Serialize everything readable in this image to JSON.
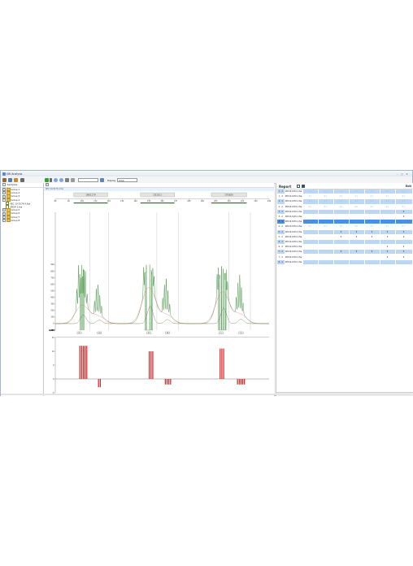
{
  "window": {
    "title": "SW Analysis",
    "buttons": {
      "minimize": "–",
      "maximize": "□",
      "close": "✕"
    }
  },
  "toolbar": {
    "zoom_value": "",
    "display_label": "Display",
    "display_value": "Area"
  },
  "navigator": {
    "header": "Samples",
    "items": [
      {
        "label": "Group 1",
        "type": "folder",
        "level": 0
      },
      {
        "label": "Group 2",
        "type": "folder",
        "level": 0
      },
      {
        "label": "Group 3",
        "type": "folder",
        "level": 0
      },
      {
        "label": "Group 4",
        "type": "folder",
        "level": 0,
        "expanded": true
      },
      {
        "label": "SEC 10-0176 A.fsa",
        "type": "file",
        "level": 1
      },
      {
        "label": "SRCM 1.fsa",
        "type": "file",
        "level": 1
      },
      {
        "label": "Group 5",
        "type": "folder",
        "level": 0
      },
      {
        "label": "Group 6",
        "type": "folder",
        "level": 0
      },
      {
        "label": "Group 7",
        "type": "folder",
        "level": 0
      },
      {
        "label": "Group 8",
        "type": "folder",
        "level": 0
      }
    ]
  },
  "center": {
    "path_text": "",
    "sample_tab": "SEC 10-0176 A.fsa"
  },
  "markers": [
    {
      "name": "D8S1179"
    },
    {
      "name": "D21S11"
    },
    {
      "name": "D7S820"
    }
  ],
  "chart_data": {
    "type": "line",
    "title": "",
    "xlabel": "",
    "ylabel": "",
    "ylim": [
      -200,
      2400
    ],
    "y_ticks": [
      "2,400",
      "2,200",
      "2,000",
      "1,800",
      "1,600",
      "1,400",
      "1,200",
      "1,000",
      "900",
      "800",
      "700",
      "600",
      "500",
      "400",
      "300",
      "200",
      "100",
      "0",
      "-100"
    ],
    "x_ticks": [
      "80",
      "90",
      "100",
      "110",
      "120",
      "130",
      "140",
      "150",
      "160",
      "170",
      "180",
      "190",
      "200",
      "210",
      "220",
      "230",
      "240"
    ],
    "series": [
      {
        "color": "#3f8f3f"
      },
      {
        "color": "#e57373"
      }
    ],
    "peak_clusters": [
      {
        "center": 100,
        "heights": [
          300,
          600,
          950,
          1100,
          900,
          500,
          200
        ]
      },
      {
        "center": 112,
        "heights": [
          200,
          380,
          450,
          300,
          150
        ]
      },
      {
        "center": 150,
        "heights": [
          400,
          900,
          1800,
          2200,
          1600,
          700,
          250
        ]
      },
      {
        "center": 163,
        "heights": [
          220,
          420,
          520,
          350,
          160
        ]
      },
      {
        "center": 205,
        "heights": [
          350,
          900,
          1500,
          1950,
          1400,
          650,
          220
        ]
      },
      {
        "center": 218,
        "heights": [
          230,
          440,
          560,
          380,
          170
        ]
      }
    ],
    "allele_labels": [
      "10",
      "14",
      "21",
      "28",
      "9",
      "13"
    ],
    "residual": {
      "ylim": [
        -5,
        15
      ],
      "y_ticks": [
        "15",
        "10",
        "5",
        "0",
        "-5"
      ],
      "groups": [
        {
          "start": 98,
          "values": [
            12,
            12,
            12,
            12,
            12
          ]
        },
        {
          "start": 112,
          "values": [
            -3,
            -3
          ]
        },
        {
          "start": 150,
          "values": [
            10,
            10,
            10
          ]
        },
        {
          "start": 162,
          "values": [
            -2,
            -2,
            -2,
            -2
          ]
        },
        {
          "start": 203,
          "values": [
            11,
            11,
            11
          ]
        },
        {
          "start": 216,
          "values": [
            -2,
            -2,
            -2,
            -2,
            -2
          ]
        }
      ]
    }
  },
  "report": {
    "title": "Report",
    "close_label": "Exit",
    "rows": [
      {
        "id": "1 - 1",
        "name": "SEC10-0176 A.fsa",
        "vals": [
          "6.1",
          "6.1",
          "6.1",
          "6.1",
          "6.1",
          "6.1",
          "6.1"
        ],
        "selected": false
      },
      {
        "id": "1 - 2",
        "name": "SEC10-0176 A.fsa",
        "vals": [
          "6.1",
          "6.1",
          "6.1",
          "6.1",
          "6.1",
          "6.1",
          "6.1"
        ],
        "selected": false
      },
      {
        "id": "2 - 1",
        "name": "SEC10-0176 A.fsa",
        "vals": [
          "6.1",
          "6.1",
          "6.1",
          "6.1",
          "6.1",
          "6.1",
          "6.1"
        ],
        "selected": false
      },
      {
        "id": "2 - 2",
        "name": "SEC10-0176 A.fsa",
        "vals": [
          "6.1",
          "6.1",
          "6.1",
          "6.1",
          "6.1",
          "6.1",
          "6.1"
        ],
        "selected": false
      },
      {
        "id": "3 - 1",
        "name": "SEC10-0176 A.fsa",
        "vals": [
          "",
          "",
          "",
          "",
          "",
          "",
          "0"
        ],
        "selected": false
      },
      {
        "id": "3 - 2",
        "name": "SEC10-0176 A.fsa",
        "vals": [
          "",
          "",
          "",
          "",
          "",
          "",
          "0"
        ],
        "selected": false
      },
      {
        "id": "4 - 1",
        "name": "SEC10-0176 A.fsa",
        "vals": [
          "",
          "",
          "",
          "",
          "",
          "",
          ""
        ],
        "selected": true
      },
      {
        "id": "4 - 2",
        "name": "SEC10-0176 A.fsa",
        "vals": [
          "6.1",
          "6.1",
          "6.1",
          "6.1",
          "6.1",
          "6.1",
          "6.1"
        ],
        "selected": false
      },
      {
        "id": "5 - 1",
        "name": "SEC10-0176 A.fsa",
        "vals": [
          "",
          "",
          "0",
          "0",
          "0",
          "0",
          "0"
        ],
        "selected": false
      },
      {
        "id": "5 - 2",
        "name": "SEC10-0176 A.fsa",
        "vals": [
          "",
          "",
          "0",
          "0",
          "0",
          "0",
          "0"
        ],
        "selected": false
      },
      {
        "id": "6 - 1",
        "name": "SEC10-0176 A.fsa",
        "vals": [
          "",
          "",
          "",
          "",
          "",
          "",
          ""
        ],
        "selected": false
      },
      {
        "id": "6 - 2",
        "name": "SEC10-0176 A.fsa",
        "vals": [
          "",
          "",
          "",
          "",
          "",
          "0",
          "0"
        ],
        "selected": false
      },
      {
        "id": "7 - 1",
        "name": "SEC10-0176 A.fsa",
        "vals": [
          "",
          "",
          "0",
          "0",
          "0",
          "0",
          "0"
        ],
        "selected": false
      },
      {
        "id": "7 - 2",
        "name": "SEC10-0176 A.fsa",
        "vals": [
          "",
          "",
          "",
          "",
          "",
          "0",
          "0"
        ],
        "selected": false
      },
      {
        "id": "8 - 1",
        "name": "SEC10-0176 A.fsa",
        "vals": [
          "",
          "",
          "",
          "",
          "",
          "",
          ""
        ],
        "selected": false
      }
    ]
  },
  "colors": {
    "accent": "#3f8f3f",
    "residual": "#d62020",
    "row_blue": "#bcd7f3",
    "row_alt": "#ffffff",
    "row_selected": "#4a90e2"
  }
}
